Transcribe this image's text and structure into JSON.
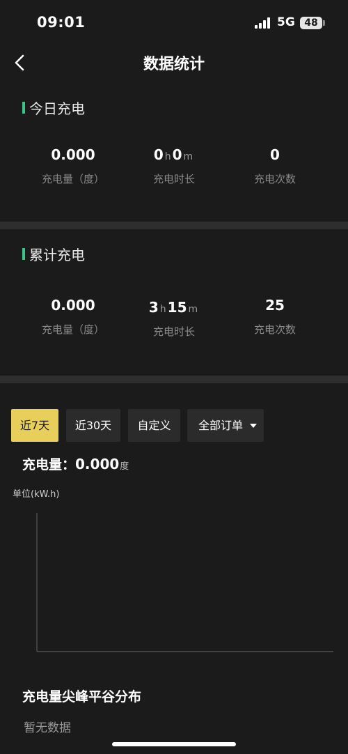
{
  "status_bar": {
    "time": "09:01",
    "network": "5G",
    "battery": "48"
  },
  "header": {
    "title": "数据统计",
    "back_icon": "chevron-left-icon"
  },
  "today": {
    "title": "今日充电",
    "energy": {
      "value": "0.000",
      "label": "充电量（度）"
    },
    "duration": {
      "hours": "0",
      "hour_unit": "h",
      "minutes": "0",
      "minute_unit": "m",
      "label": "充电时长"
    },
    "count": {
      "value": "0",
      "label": "充电次数"
    }
  },
  "cumulative": {
    "title": "累计充电",
    "energy": {
      "value": "0.000",
      "label": "充电量（度）"
    },
    "duration": {
      "hours": "3",
      "hour_unit": "h",
      "minutes": "15",
      "minute_unit": "m",
      "label": "充电时长"
    },
    "count": {
      "value": "25",
      "label": "充电次数"
    }
  },
  "filters": {
    "last7": "近7天",
    "last30": "近30天",
    "custom": "自定义",
    "order_type": "全部订单",
    "active": "last7"
  },
  "summary": {
    "label": "充电量：",
    "value": "0.000",
    "unit": "度"
  },
  "chart_data": {
    "type": "line",
    "ylabel": "单位(kW.h)",
    "series": [],
    "grid": false
  },
  "distribution": {
    "title": "充电量尖峰平谷分布",
    "empty_text": "暂无数据"
  },
  "colors": {
    "background": "#1b1b1b",
    "accent_green": "#3fc28a",
    "active_filter": "#e8cf5c",
    "divider": "#2e2e2e"
  }
}
